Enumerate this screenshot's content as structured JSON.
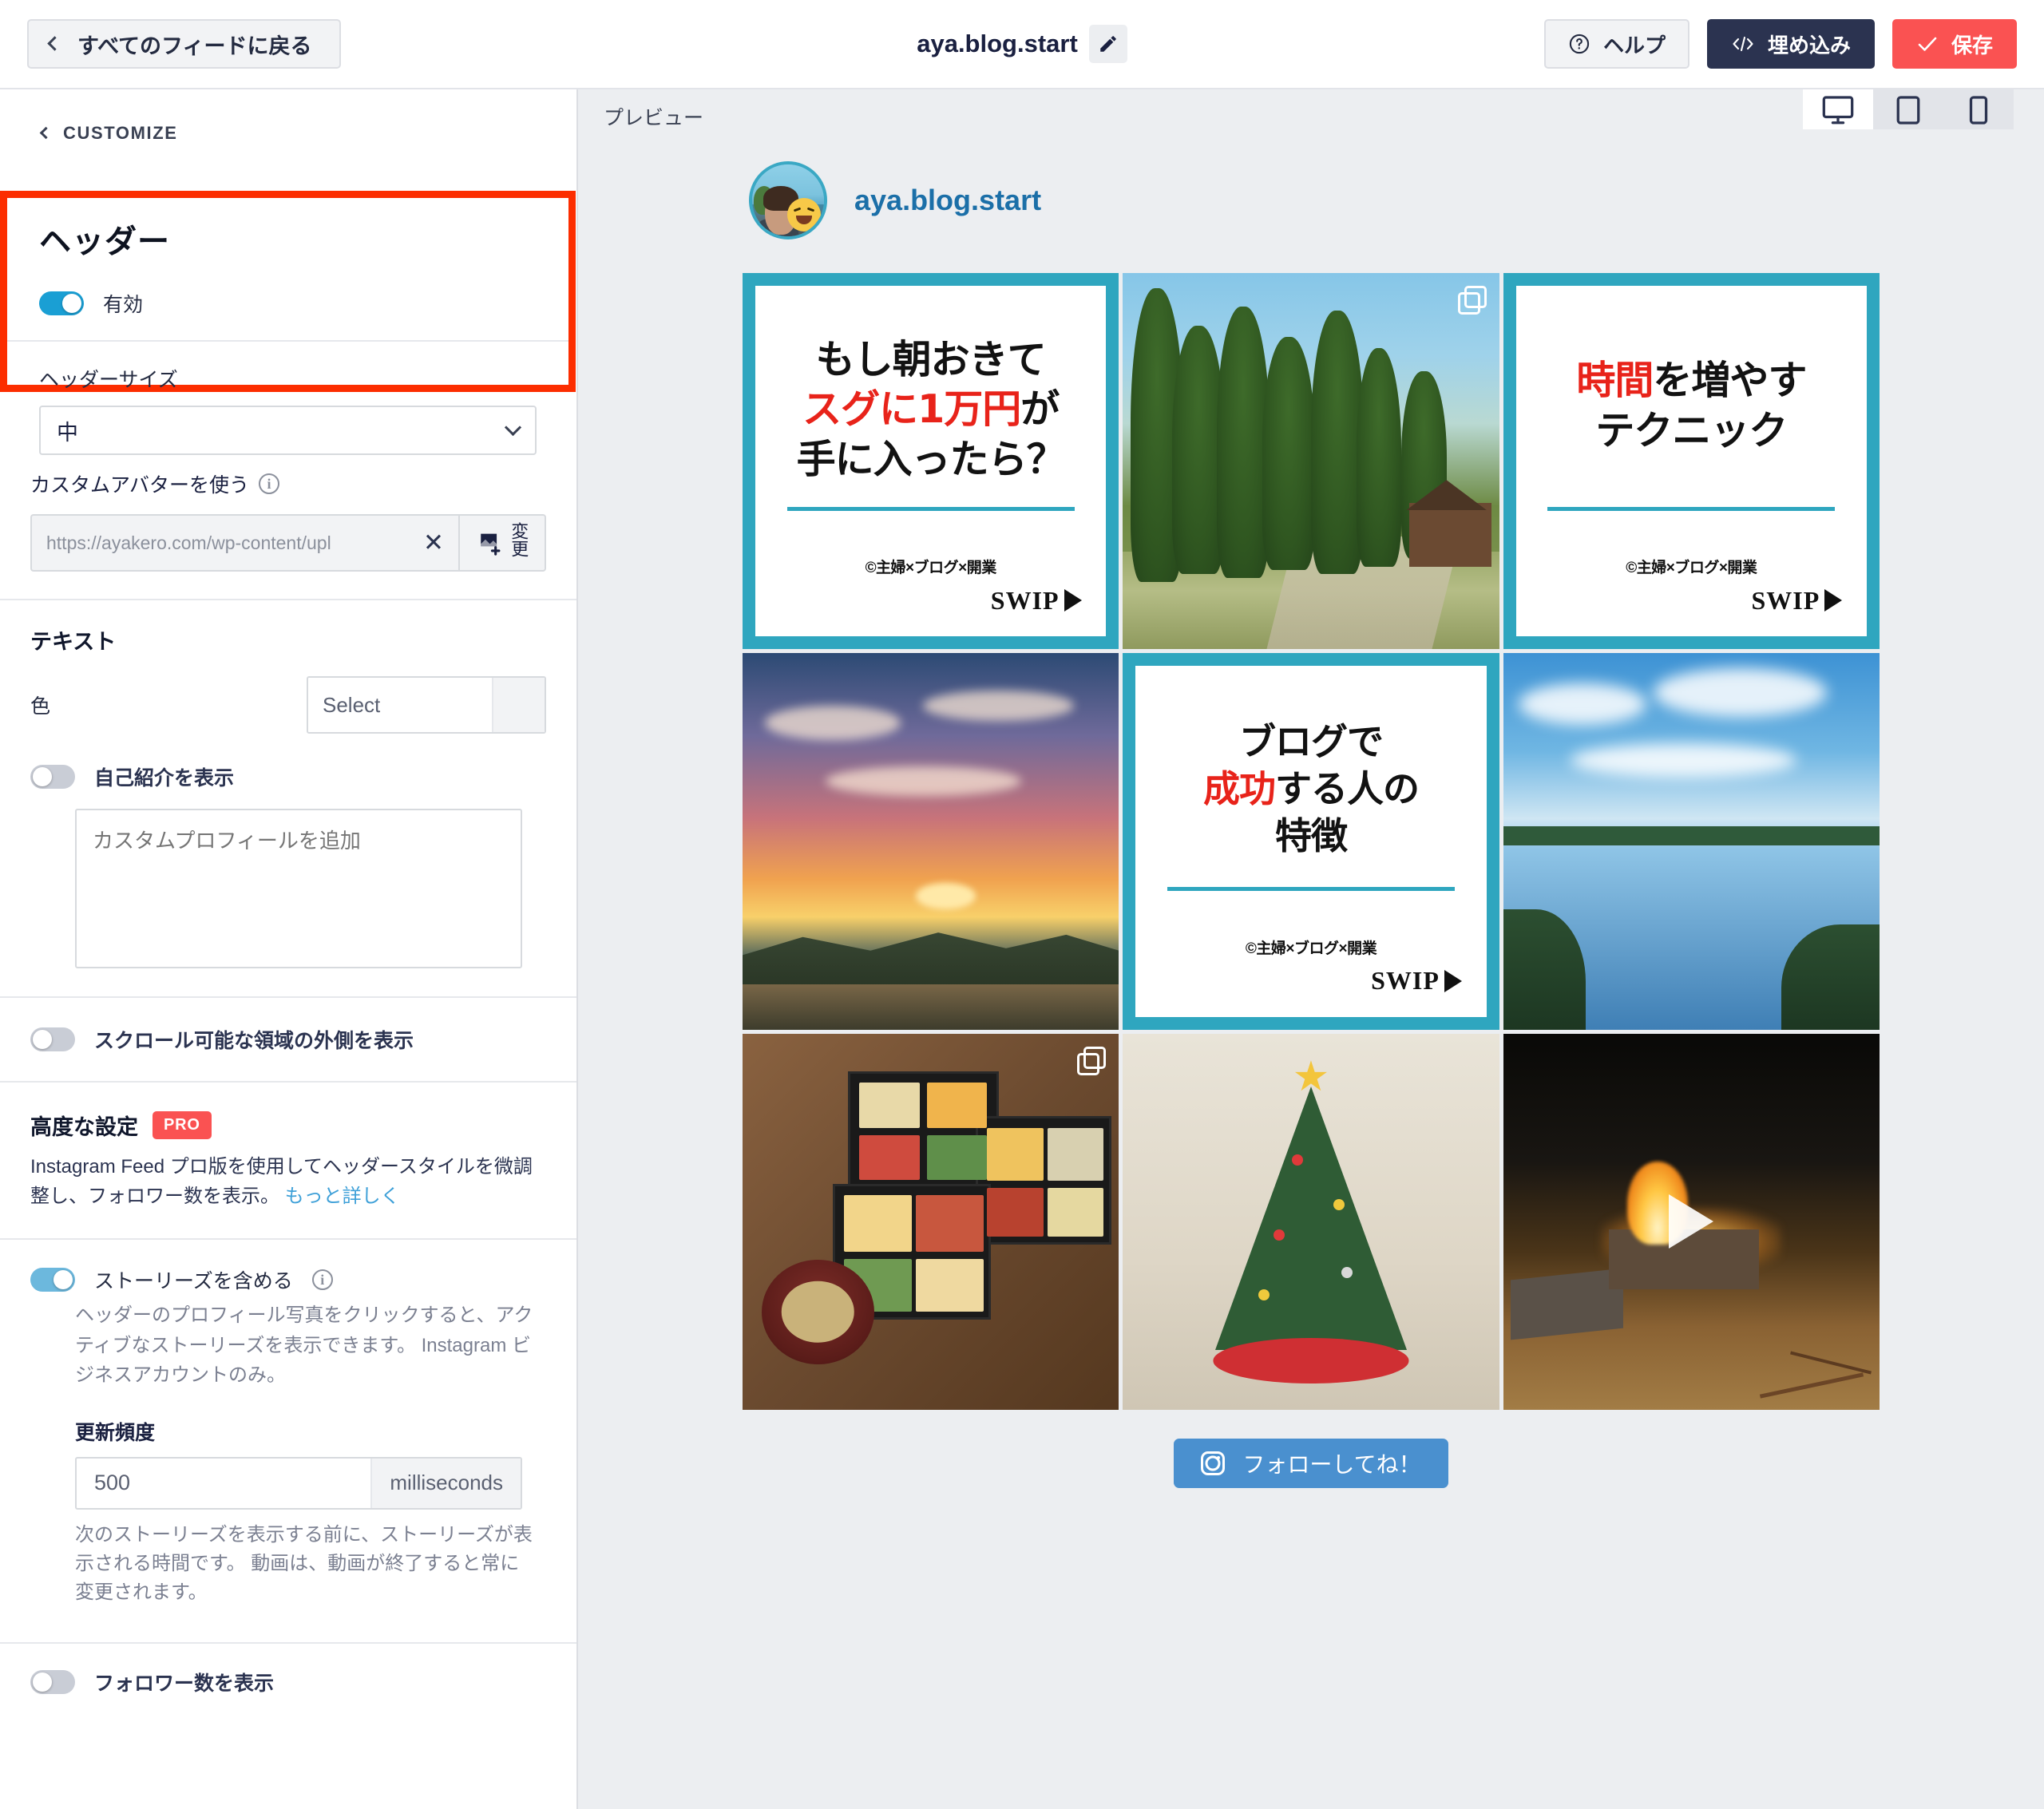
{
  "topbar": {
    "back_label": "すべてのフィードに戻る",
    "feed_title": "aya.blog.start",
    "help_label": "ヘルプ",
    "embed_label": "埋め込み",
    "save_label": "保存"
  },
  "sidebar": {
    "customize_label": "CUSTOMIZE",
    "header_section": {
      "title": "ヘッダー",
      "enabled_label": "有効",
      "enabled": true,
      "size_label": "ヘッダーサイズ",
      "size_value": "中"
    },
    "avatar": {
      "label": "カスタムアバターを使う",
      "url_value": "https://ayakero.com/wp-content/upl",
      "clear_label": "✕",
      "change_label": "変更"
    },
    "text": {
      "heading": "テキスト",
      "color_label": "色",
      "color_placeholder": "Select"
    },
    "bio": {
      "toggle_label": "自己紹介を表示",
      "enabled": false,
      "textarea_placeholder": "カスタムプロフィールを追加"
    },
    "outside_scroll": {
      "toggle_label": "スクロール可能な領域の外側を表示",
      "enabled": false
    },
    "advanced": {
      "title": "高度な設定",
      "badge": "PRO",
      "description": "Instagram Feed プロ版を使用してヘッダースタイルを微調整し、フォロワー数を表示。",
      "link_label": "もっと詳しく"
    },
    "stories": {
      "toggle_label": "ストーリーズを含める",
      "enabled": true,
      "description": "ヘッダーのプロフィール写真をクリックすると、アクティブなストーリーズを表示できます。 Instagram ビジネスアカウントのみ。",
      "frequency_label": "更新頻度",
      "frequency_value": "500",
      "frequency_unit": "milliseconds",
      "frequency_description": "次のストーリーズを表示する前に、ストーリーズが表示される時間です。 動画は、動画が終了すると常に変更されます。"
    },
    "follower_count": {
      "toggle_label": "フォロワー数を表示",
      "enabled": false
    }
  },
  "preview": {
    "label": "プレビュー",
    "devices": [
      {
        "name": "desktop",
        "active": true
      },
      {
        "name": "tablet",
        "active": false
      },
      {
        "name": "mobile",
        "active": false
      }
    ],
    "feed_username": "aya.blog.start",
    "follow_label": "フォローしてね！",
    "posts": [
      {
        "kind": "text-card",
        "media_type": "carousel",
        "line1_pre": "もし朝おきて",
        "line2_red": "スグに1万円",
        "line2_post": "が",
        "line3": "手に入ったら？",
        "credit": "©主婦×ブログ×開業",
        "swipe_label": "SWIP"
      },
      {
        "kind": "photo-forest",
        "media_type": "carousel",
        "alt": "杉林の砂利道と山小屋"
      },
      {
        "kind": "text-card",
        "media_type": "carousel",
        "line1_red": "時間",
        "line1_post": "を増やす",
        "line2": "テクニック",
        "credit": "©主婦×ブログ×開業",
        "swipe_label": "SWIP"
      },
      {
        "kind": "photo-sunset",
        "media_type": "image",
        "alt": "湖に沈む夕日"
      },
      {
        "kind": "text-card",
        "media_type": "carousel",
        "line1": "ブログで",
        "line2_red": "成功",
        "line2_post": "する人の",
        "line3": "特徴",
        "credit": "©主婦×ブログ×開業",
        "swipe_label": "SWIP"
      },
      {
        "kind": "photo-lake",
        "media_type": "image",
        "alt": "青空と湖"
      },
      {
        "kind": "photo-food",
        "media_type": "carousel",
        "alt": "おせち料理の重箱とお椀"
      },
      {
        "kind": "photo-xmas",
        "media_type": "image",
        "alt": "クリスマスツリー"
      },
      {
        "kind": "photo-fire",
        "media_type": "video",
        "alt": "夜の焚き火"
      }
    ]
  },
  "colors": {
    "accent_red": "#fa5252",
    "highlight_box": "#fc2d00",
    "embed_navy": "#2b3350",
    "toggle_on": "#1a9fd4",
    "link_blue": "#3ea0d8",
    "card_teal": "#2fa6bf",
    "card_red": "#e8231a",
    "follow_blue": "#4a90cf",
    "username_blue": "#1b6fa8"
  }
}
